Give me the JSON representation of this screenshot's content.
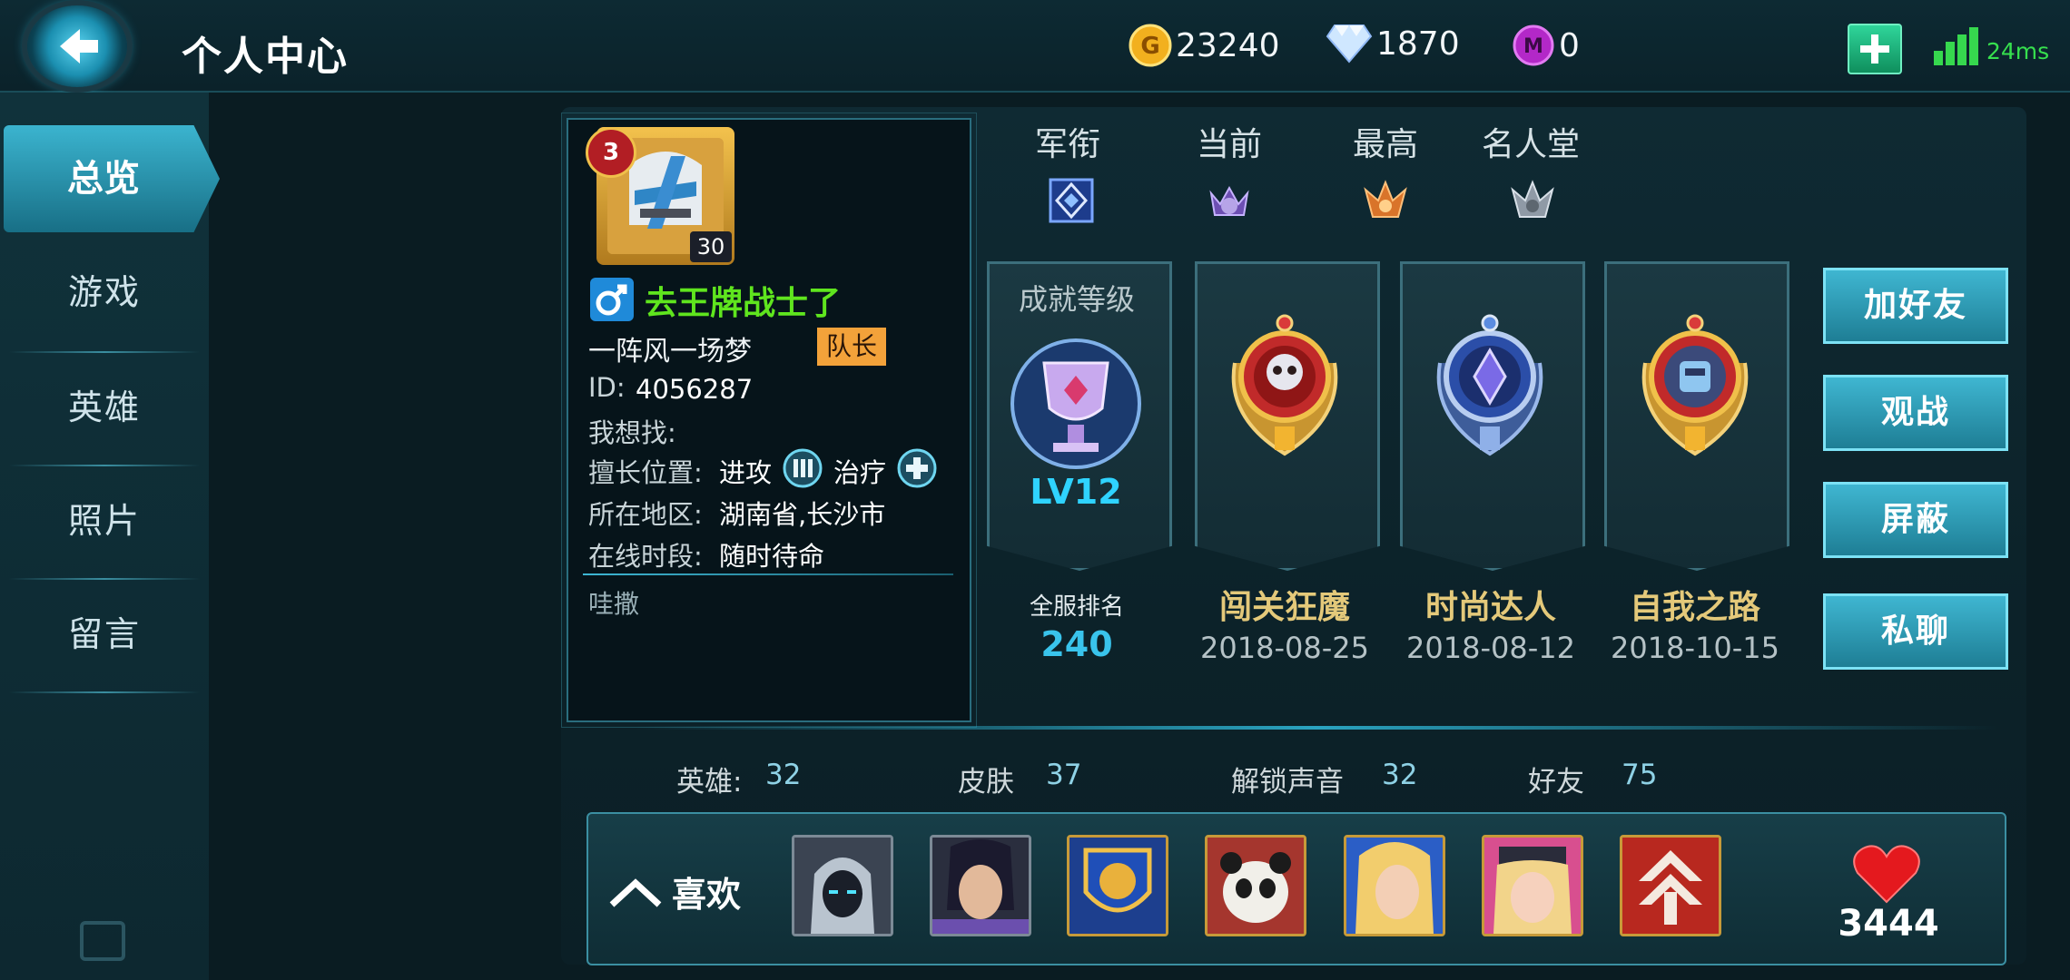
{
  "header": {
    "title": "个人中心",
    "gold": "23240",
    "diamonds": "1870",
    "gems": "0",
    "ping": "24ms"
  },
  "sidebar": {
    "items": [
      {
        "label": "总览",
        "active": true
      },
      {
        "label": "游戏"
      },
      {
        "label": "英雄"
      },
      {
        "label": "照片"
      },
      {
        "label": "留言"
      }
    ]
  },
  "profile": {
    "rank_badge": "3",
    "level": "30",
    "nickname": "去王牌战士了",
    "signature": "一阵风一场梦",
    "captain_tag": "队长",
    "id_label": "ID:",
    "id_value": "4056287",
    "looking_for_label": "我想找:",
    "position_label": "擅长位置:",
    "positions": [
      "进攻",
      "治疗"
    ],
    "region_label": "所在地区:",
    "region_value": "湖南省,长沙市",
    "online_label": "在线时段:",
    "online_value": "随时待命",
    "note": "哇撒"
  },
  "ranks": {
    "headers": [
      "军衔",
      "当前",
      "最高",
      "名人堂"
    ]
  },
  "achievements": {
    "level_title": "成就等级",
    "level_value": "LV12",
    "server_rank_label": "全服排名",
    "server_rank_value": "240",
    "items": [
      {
        "name": "闯关狂魔",
        "date": "2018-08-25"
      },
      {
        "name": "时尚达人",
        "date": "2018-08-12"
      },
      {
        "name": "自我之路",
        "date": "2018-10-15"
      }
    ]
  },
  "actions": {
    "add_friend": "加好友",
    "spectate": "观战",
    "block": "屏蔽",
    "private_chat": "私聊"
  },
  "stats": {
    "heroes_label": "英雄:",
    "heroes_value": "32",
    "skins_label": "皮肤",
    "skins_value": "37",
    "voices_label": "解锁声音",
    "voices_value": "32",
    "friends_label": "好友",
    "friends_value": "75"
  },
  "favorites": {
    "label": "喜欢",
    "likes": "3444"
  },
  "colors": {
    "accent": "#3fb6d1",
    "nickname": "#5fe51e",
    "gold_text": "#e4c97a",
    "captain_tag": "#f3a23a"
  }
}
